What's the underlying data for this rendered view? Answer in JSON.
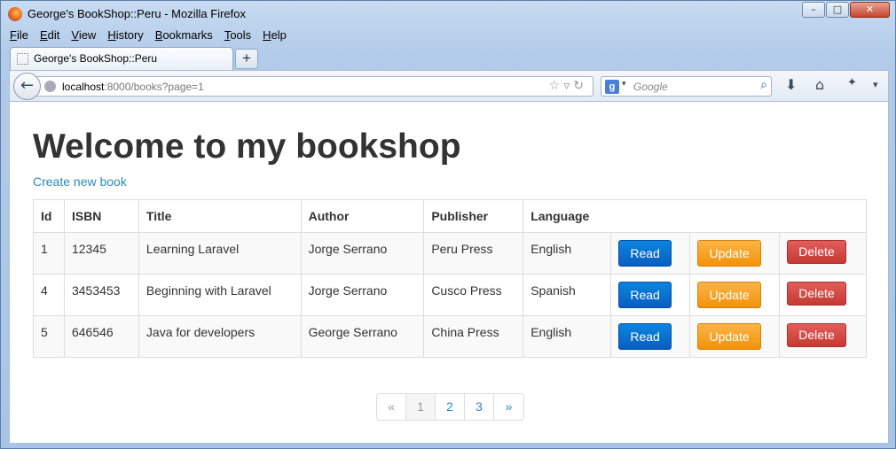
{
  "window": {
    "title": "George's BookShop::Peru - Mozilla Firefox",
    "controls": {
      "minimize": "–",
      "maximize": "□",
      "close": "✕"
    }
  },
  "menu": [
    "File",
    "Edit",
    "View",
    "History",
    "Bookmarks",
    "Tools",
    "Help"
  ],
  "menu_underline": [
    "F",
    "E",
    "V",
    "H",
    "B",
    "T",
    "H"
  ],
  "tab": {
    "title": "George's BookShop::Peru",
    "new_tab_label": "+"
  },
  "address": {
    "host": "localhost",
    "rest": ":8000/books?page=1"
  },
  "search": {
    "placeholder": "Google",
    "engine_letter": "g"
  },
  "page": {
    "heading": "Welcome to my bookshop",
    "create_link": "Create new book"
  },
  "table": {
    "headers": [
      "Id",
      "ISBN",
      "Title",
      "Author",
      "Publisher",
      "Language"
    ],
    "rows": [
      {
        "id": "1",
        "isbn": "12345",
        "title": "Learning Laravel",
        "author": "Jorge Serrano",
        "publisher": "Peru Press",
        "language": "English"
      },
      {
        "id": "4",
        "isbn": "3453453",
        "title": "Beginning with Laravel",
        "author": "Jorge Serrano",
        "publisher": "Cusco Press",
        "language": "Spanish"
      },
      {
        "id": "5",
        "isbn": "646546",
        "title": "Java for developers",
        "author": "George Serrano",
        "publisher": "China Press",
        "language": "English"
      }
    ],
    "actions": {
      "read": "Read",
      "update": "Update",
      "delete": "Delete"
    }
  },
  "pagination": {
    "prev": "«",
    "pages": [
      "1",
      "2",
      "3"
    ],
    "next": "»",
    "current_page": 1
  },
  "colors": {
    "link": "#2a8bb7",
    "read": "#0a6fd0",
    "update": "#f5a020",
    "delete": "#d0443f"
  }
}
